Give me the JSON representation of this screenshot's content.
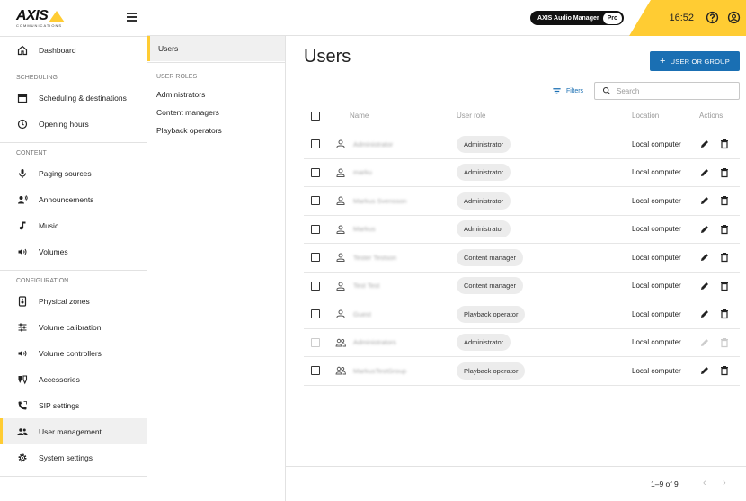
{
  "brand": {
    "logo_text": "AXIS",
    "logo_subtext": "COMMUNICATIONS"
  },
  "header": {
    "product_name": "AXIS Audio Manager",
    "product_tier": "Pro",
    "time": "16:52"
  },
  "sidebar": {
    "dashboard": "Dashboard",
    "scheduling_label": "SCHEDULING",
    "scheduling_items": [
      "Scheduling & destinations",
      "Opening hours"
    ],
    "content_label": "CONTENT",
    "content_items": [
      "Paging sources",
      "Announcements",
      "Music",
      "Volumes"
    ],
    "configuration_label": "CONFIGURATION",
    "configuration_items": [
      "Physical zones",
      "Volume calibration",
      "Volume controllers",
      "Accessories",
      "SIP settings",
      "User management",
      "System settings"
    ]
  },
  "subnav": {
    "users": "Users",
    "roles_label": "USER ROLES",
    "roles": [
      "Administrators",
      "Content managers",
      "Playback operators"
    ]
  },
  "main": {
    "title": "Users",
    "add_button": "USER OR GROUP",
    "filters": "Filters",
    "search_placeholder": "Search",
    "columns": {
      "name": "Name",
      "role": "User role",
      "location": "Location",
      "actions": "Actions"
    },
    "rows": [
      {
        "name": "Administrator",
        "role": "Administrator",
        "location": "Local computer",
        "type": "user"
      },
      {
        "name": "marku",
        "role": "Administrator",
        "location": "Local computer",
        "type": "user"
      },
      {
        "name": "Markus Svensson",
        "role": "Administrator",
        "location": "Local computer",
        "type": "user"
      },
      {
        "name": "Markus",
        "role": "Administrator",
        "location": "Local computer",
        "type": "user"
      },
      {
        "name": "Tester Testson",
        "role": "Content manager",
        "location": "Local computer",
        "type": "user"
      },
      {
        "name": "Test Test",
        "role": "Content manager",
        "location": "Local computer",
        "type": "user"
      },
      {
        "name": "Guest",
        "role": "Playback operator",
        "location": "Local computer",
        "type": "user"
      },
      {
        "name": "Administrators",
        "role": "Administrator",
        "location": "Local computer",
        "type": "group",
        "disabled": true
      },
      {
        "name": "MarkusTestGroup",
        "role": "Playback operator",
        "location": "Local computer",
        "type": "group"
      }
    ],
    "pagination": "1–9 of 9"
  },
  "colors": {
    "accent": "#ffcc33",
    "primary": "#1a6fb3"
  }
}
